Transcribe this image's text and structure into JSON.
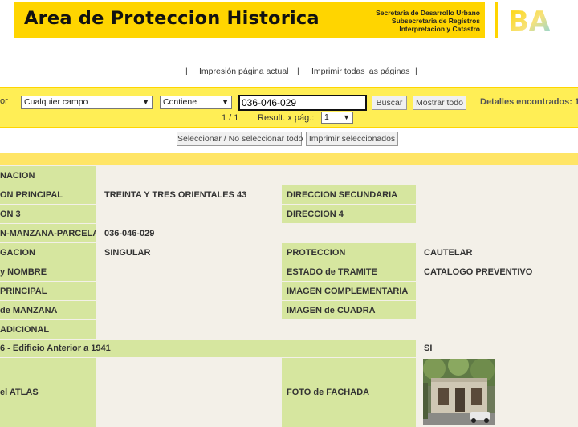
{
  "header": {
    "title": "Area de Proteccion Historica",
    "sub": [
      "Secretaria de Desarrollo Urbano",
      "Subsecretaria de Registros",
      "Interpretacion y Catastro"
    ],
    "logo_text": "BA",
    "brand_color": "#ffd500"
  },
  "print_links": {
    "sep": "|",
    "current": "Impresión página actual",
    "all": "Imprimir todas las páginas"
  },
  "filter": {
    "label_fragment": "or",
    "field_select": "Cualquier campo",
    "operator_select": "Contiene",
    "search_value": "036-046-029",
    "search_button": "Buscar",
    "show_all_button": "Mostrar todo",
    "found_label": "Detalles encontrados: 1",
    "page_indicator": "1 / 1",
    "per_page_label": "Result. x pág.:",
    "per_page_value": "1"
  },
  "actions": {
    "select_toggle": "Seleccionar / No seleccionar todo",
    "print_selected": "Imprimir seleccionados"
  },
  "record": {
    "r1_label": "NACION",
    "r2_label": "ON PRINCIPAL",
    "r2_value": "TREINTA Y TRES ORIENTALES 43",
    "r2_label2": "DIRECCION SECUNDARIA",
    "r3_label": "ON 3",
    "r3_label2": "DIRECCION 4",
    "r4_label": "N-MANZANA-PARCELA",
    "r4_value": "036-046-029",
    "r5_label": "GACION",
    "r5_value": "SINGULAR",
    "r5_label2": "PROTECCION",
    "r5_value2": "CAUTELAR",
    "r6_label": "y NOMBRE",
    "r6_label2": "ESTADO de TRAMITE",
    "r6_value2": "CATALOGO PREVENTIVO",
    "r7_label": "PRINCIPAL",
    "r7_label2": "IMAGEN COMPLEMENTARIA",
    "r8_label": "de MANZANA",
    "r8_label2": "IMAGEN de CUADRA",
    "r9_label": "ADICIONAL",
    "r10_label": "6 - Edificio Anterior a 1941",
    "r10_value": "SI",
    "r11_label": "el ATLAS",
    "r11_label2": "FOTO de FACHADA"
  }
}
